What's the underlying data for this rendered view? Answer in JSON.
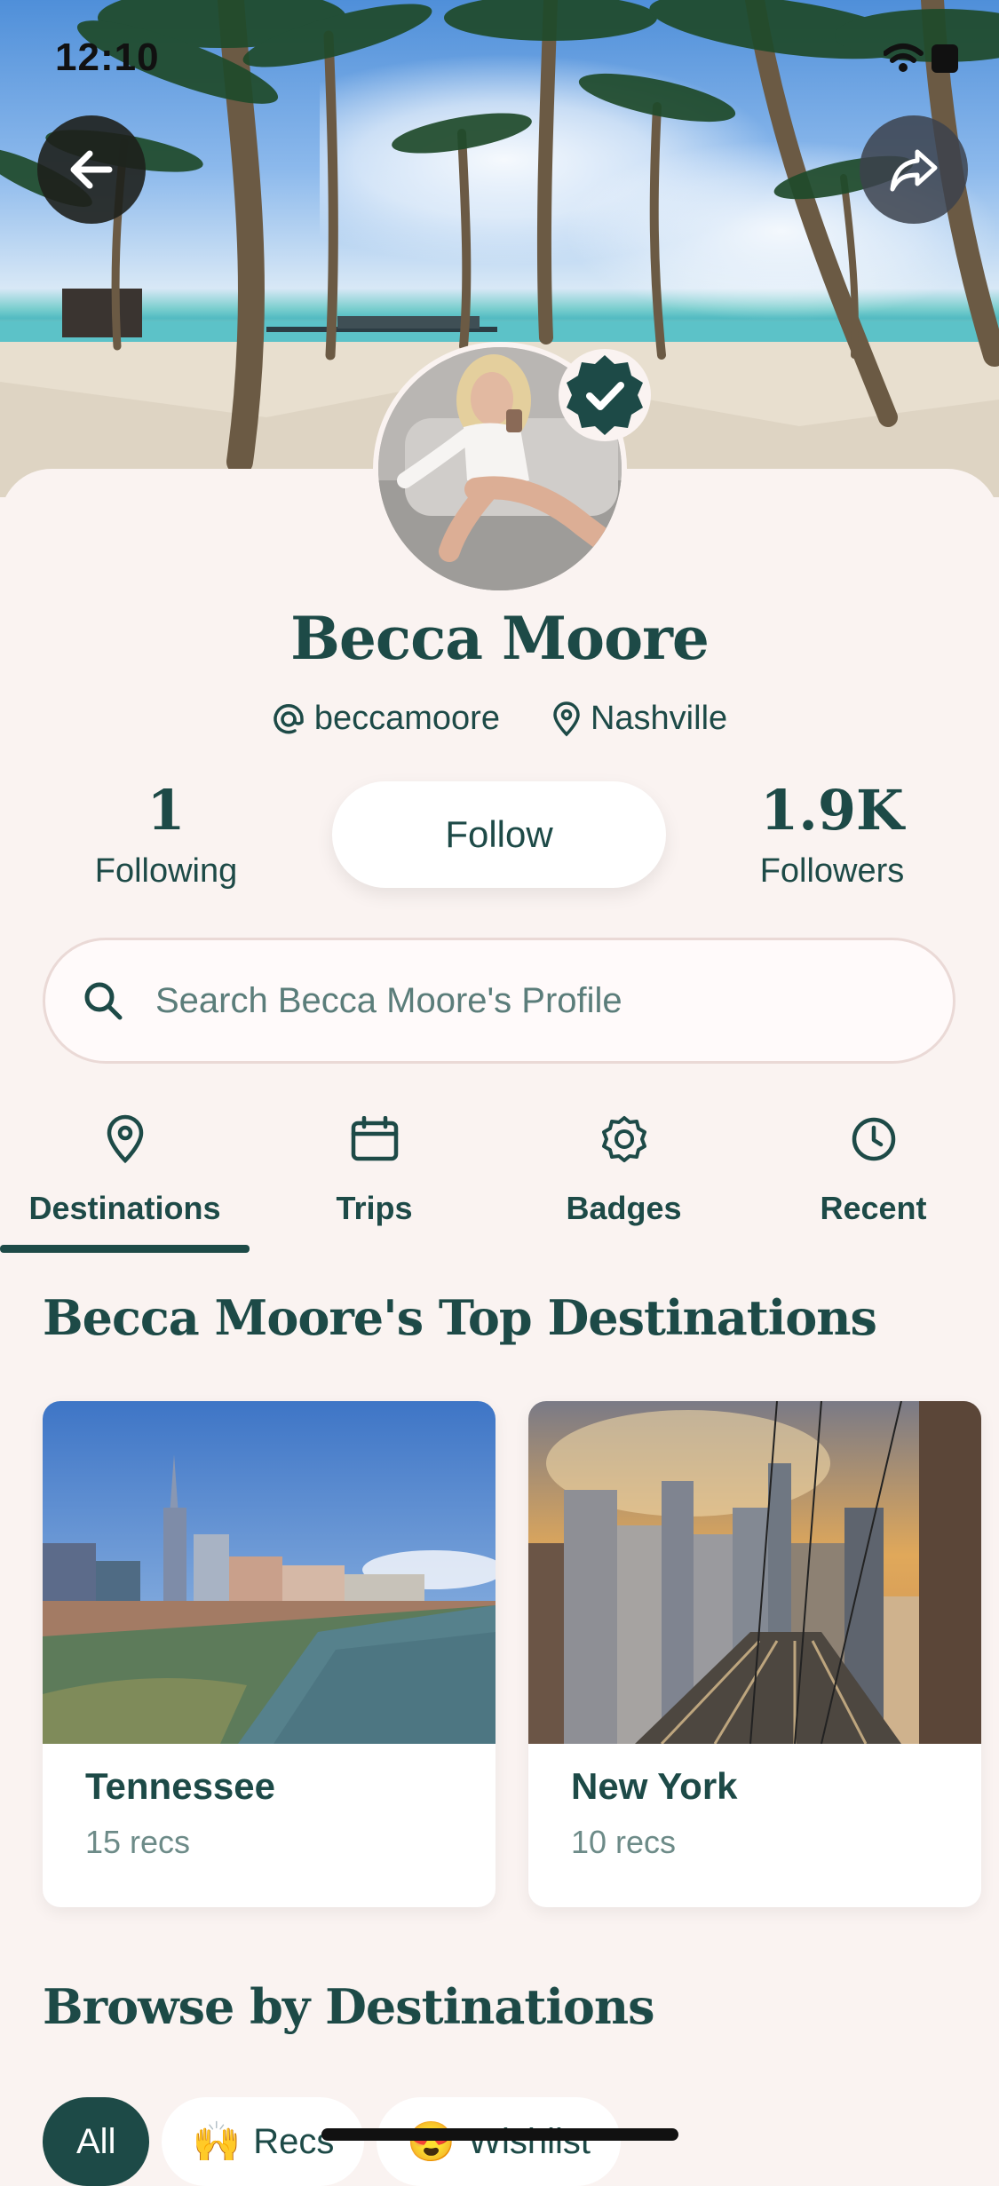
{
  "status_bar": {
    "time": "12:10"
  },
  "profile": {
    "name": "Becca Moore",
    "handle": "beccamoore",
    "location": "Nashville",
    "following_count": "1",
    "following_label": "Following",
    "followers_count": "1.9K",
    "followers_label": "Followers",
    "follow_label": "Follow"
  },
  "search": {
    "placeholder": "Search Becca Moore's Profile"
  },
  "tabs": [
    {
      "label": "Destinations",
      "icon": "map-pin-icon",
      "active": true
    },
    {
      "label": "Trips",
      "icon": "calendar-icon",
      "active": false
    },
    {
      "label": "Badges",
      "icon": "badge-icon",
      "active": false
    },
    {
      "label": "Recent",
      "icon": "clock-icon",
      "active": false
    }
  ],
  "top_destinations": {
    "title": "Becca Moore's Top Destinations",
    "cards": [
      {
        "name": "Tennessee",
        "recs": "15 recs"
      },
      {
        "name": "New York",
        "recs": "10 recs"
      }
    ]
  },
  "browse": {
    "title": "Browse by Destinations",
    "chips": [
      {
        "label": "All",
        "emoji": "",
        "active": true
      },
      {
        "label": "Recs",
        "emoji": "🙌",
        "active": false
      },
      {
        "label": "Wishlist",
        "emoji": "😍",
        "active": false
      }
    ]
  },
  "colors": {
    "primary": "#1d4a47",
    "background": "#faf3f1"
  }
}
